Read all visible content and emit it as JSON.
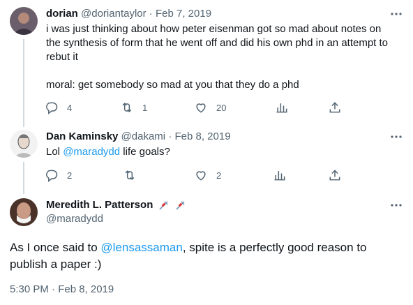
{
  "tweets": [
    {
      "name": "dorian",
      "handle": "@doriantaylor",
      "sep": "·",
      "date": "Feb 7, 2019",
      "lines": [
        "i was just thinking about how peter eisenman got so mad about notes on",
        "the synthesis of form that he went off and did his own phd in an attempt to",
        "rebut it",
        "",
        "moral: get somebody so mad at you that they do a phd"
      ],
      "replies": "4",
      "retweets": "1",
      "likes": "20"
    },
    {
      "name": "Dan Kaminsky",
      "handle": "@dakami",
      "sep": "·",
      "date": "Feb 8, 2019",
      "text_before": "Lol ",
      "mention": "@maradydd",
      "text_after": " life goals?",
      "replies": "2",
      "retweets": "",
      "likes": "2"
    }
  ],
  "main": {
    "name": "Meredith L. Patterson",
    "handle": "@maradydd",
    "text_before": "As I once said to ",
    "mention": "@lensassaman",
    "text_line1_after": ", spite is a perfectly good reason to",
    "text_line2": "publish a paper :)",
    "time": "5:30 PM · Feb 8, 2019"
  },
  "icons": [
    "more-icon",
    "reply-icon",
    "retweet-icon",
    "like-icon",
    "views-icon",
    "share-icon",
    "syringe-icon"
  ],
  "colors": {
    "link": "#1d9bf0",
    "muted": "#536471",
    "text": "#0f1419",
    "thread_line": "#cfd9de"
  }
}
